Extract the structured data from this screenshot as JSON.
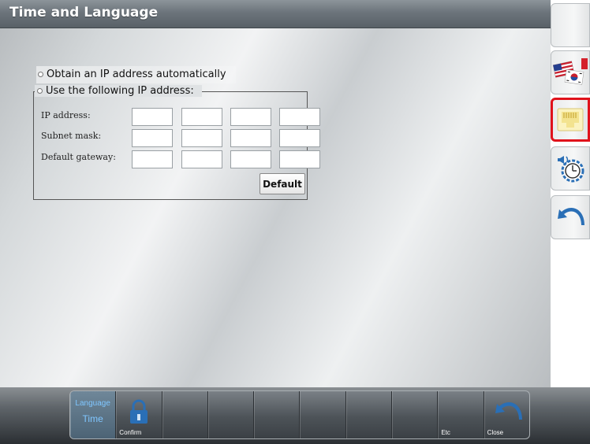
{
  "window": {
    "title": "Time and Language"
  },
  "network": {
    "option_auto": "Obtain an IP address automatically",
    "option_manual": "Use the following IP address:",
    "fields": [
      {
        "label": "IP address:",
        "octets": [
          "",
          "",
          "",
          ""
        ]
      },
      {
        "label": "Subnet mask:",
        "octets": [
          "",
          "",
          "",
          ""
        ]
      },
      {
        "label": "Default gateway:",
        "octets": [
          "",
          "",
          "",
          ""
        ]
      }
    ],
    "default_button": "Default"
  },
  "sidebar": {
    "items": [
      {
        "icon": "blank-icon"
      },
      {
        "icon": "language-flags-icon"
      },
      {
        "icon": "network-port-icon",
        "selected": true
      },
      {
        "icon": "time-settings-icon"
      },
      {
        "icon": "back-arrow-icon"
      }
    ]
  },
  "toolbar": {
    "language_label": "Language",
    "time_label": "Time",
    "confirm_label": "Confirm",
    "etc_label": "Etc",
    "close_label": "Close"
  },
  "colors": {
    "selection_border": "#e0121b",
    "icon_blue": "#2a6fb6",
    "language_text": "#7fc6ff"
  }
}
